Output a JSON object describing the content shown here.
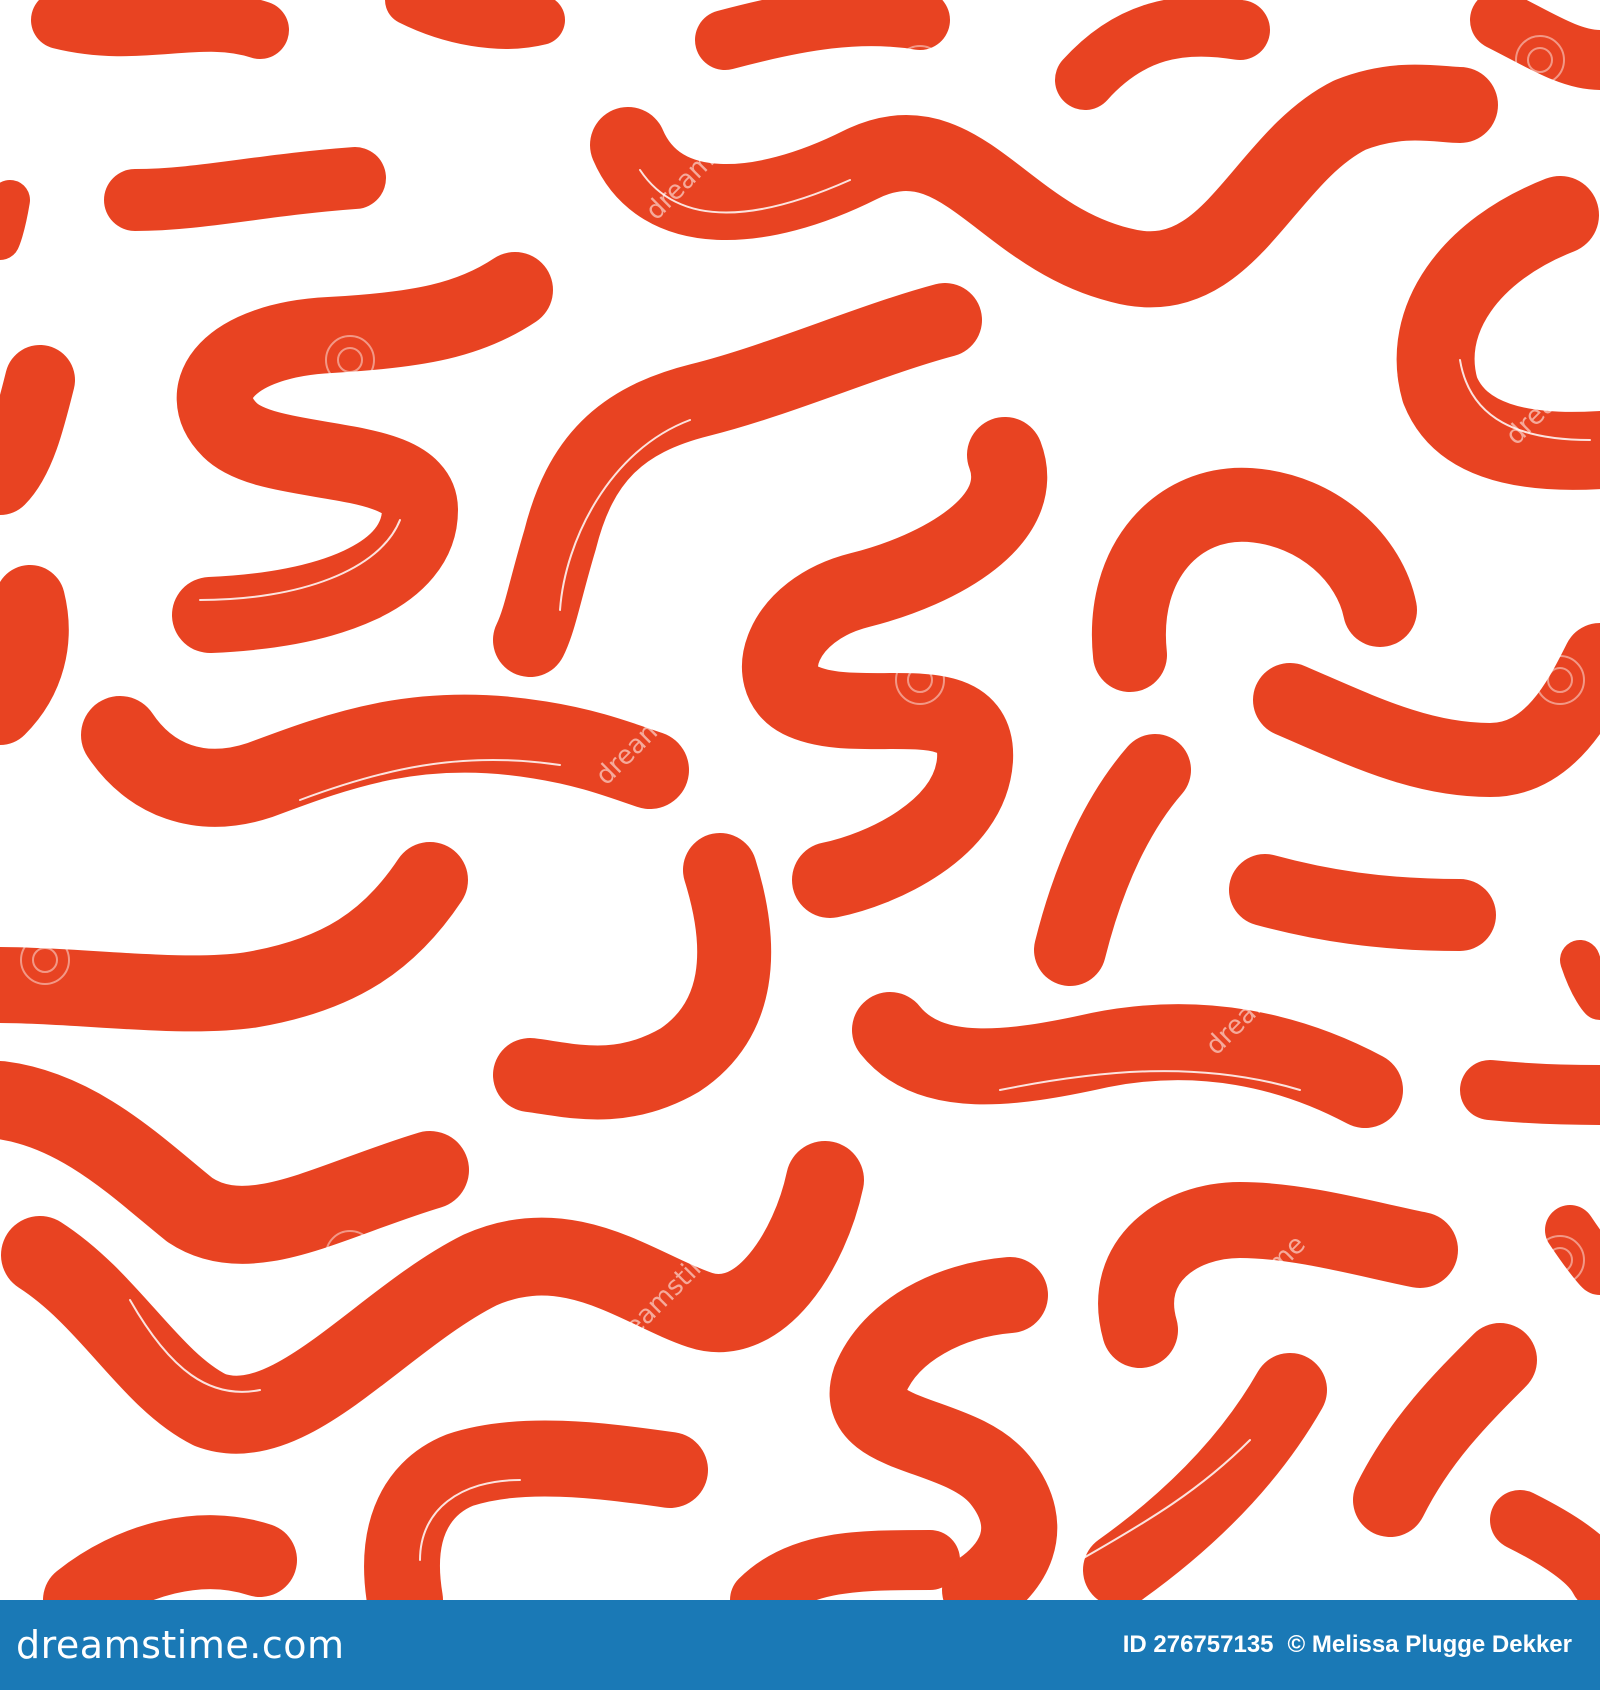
{
  "image": {
    "background_color": "#ffffff",
    "stroke_color": "#e84322",
    "footer_color": "#1a79b6"
  },
  "watermark": {
    "text": "dreamstime"
  },
  "footer": {
    "brand": "dreamstime.com",
    "id_text": "ID 276757135",
    "author_text": "© Melissa Plugge Dekker"
  }
}
